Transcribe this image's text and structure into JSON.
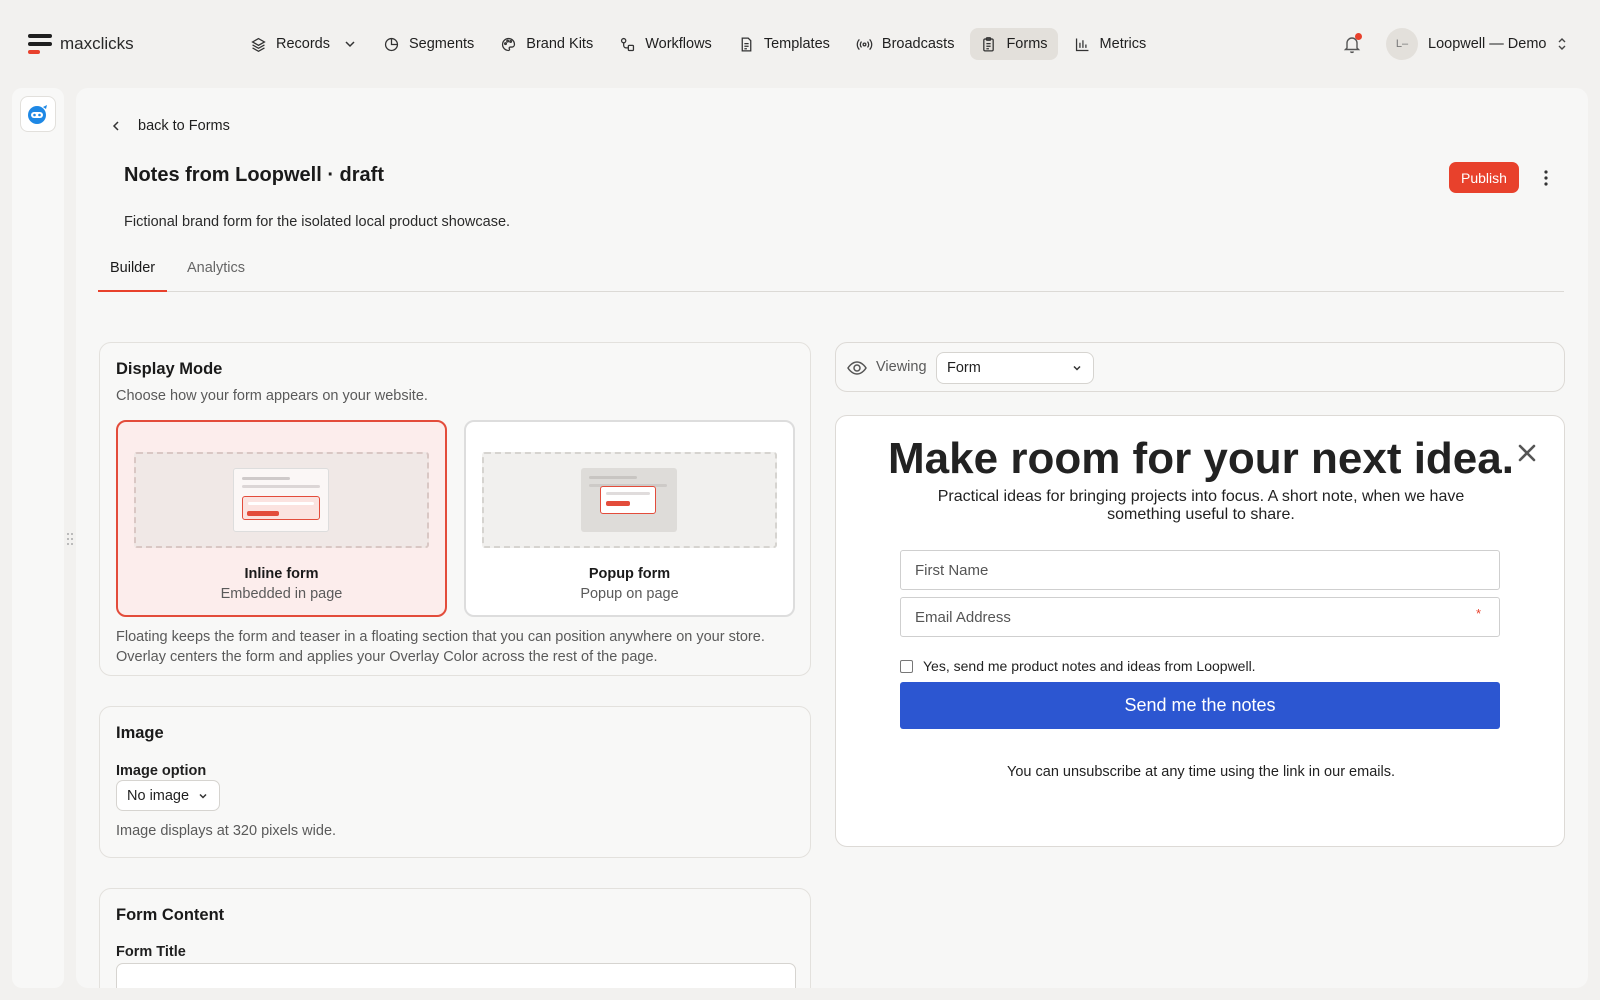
{
  "brand": {
    "name": "maxclicks",
    "accent": "#e8412c"
  },
  "nav": {
    "items": [
      {
        "label": "Records",
        "icon": "layers-icon",
        "dropdown": true
      },
      {
        "label": "Segments",
        "icon": "pie-icon"
      },
      {
        "label": "Brand Kits",
        "icon": "palette-icon"
      },
      {
        "label": "Workflows",
        "icon": "workflow-icon"
      },
      {
        "label": "Templates",
        "icon": "document-icon"
      },
      {
        "label": "Broadcasts",
        "icon": "broadcast-icon"
      },
      {
        "label": "Forms",
        "icon": "clipboard-icon",
        "active": true
      },
      {
        "label": "Metrics",
        "icon": "bar-chart-icon"
      }
    ]
  },
  "account": {
    "avatar_text": "L–",
    "name": "Loopwell — Demo"
  },
  "header": {
    "back_label": "back to Forms",
    "title": "Notes from Loopwell · draft",
    "description": "Fictional brand form for the isolated local product showcase.",
    "publish_label": "Publish"
  },
  "tabs": [
    {
      "label": "Builder",
      "active": true
    },
    {
      "label": "Analytics",
      "active": false
    }
  ],
  "display_mode": {
    "title": "Display Mode",
    "subtitle": "Choose how your form appears on your website.",
    "options": [
      {
        "label": "Inline form",
        "sub": "Embedded in page",
        "selected": true
      },
      {
        "label": "Popup form",
        "sub": "Popup on page",
        "selected": false
      }
    ],
    "note": "Floating keeps the form and teaser in a floating section that you can position anywhere on your store. Overlay centers the form and applies your Overlay Color across the rest of the page."
  },
  "image": {
    "title": "Image",
    "option_label": "Image option",
    "option_value": "No image",
    "note": "Image displays at 320 pixels wide."
  },
  "form_content": {
    "title": "Form Content",
    "form_title_label": "Form Title"
  },
  "viewer": {
    "label": "Viewing",
    "value": "Form"
  },
  "preview": {
    "title": "Make room for your next idea.",
    "description": "Practical ideas for bringing projects into focus. A short note, when we have something useful to share.",
    "first_name_placeholder": "First Name",
    "email_placeholder": "Email Address",
    "required_mark": "*",
    "consent": "Yes, send me product notes and ideas from Loopwell.",
    "button": "Send me the notes",
    "footer": "You can unsubscribe at any time using the link in our emails.",
    "button_color": "#2c56d1"
  }
}
